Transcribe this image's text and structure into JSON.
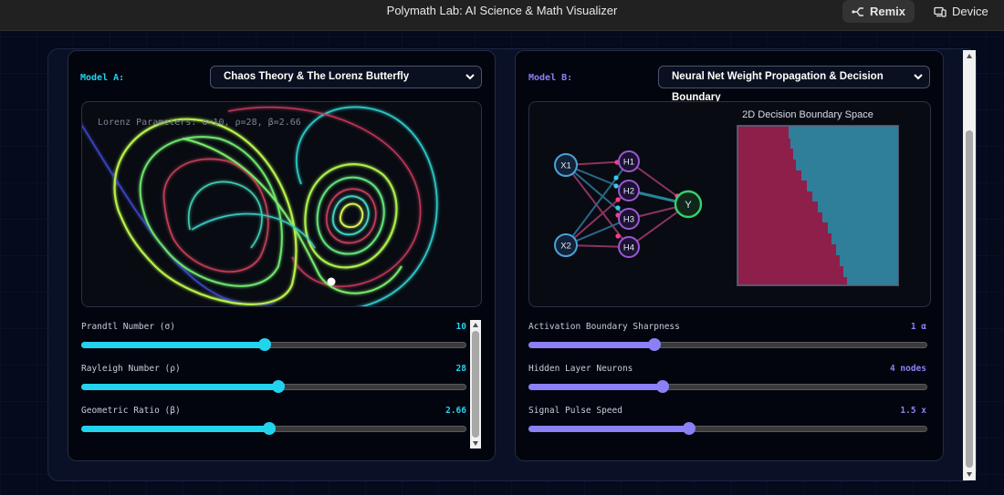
{
  "app": {
    "title": "Polymath Lab: AI Science & Math Visualizer",
    "remix_label": "Remix",
    "device_label": "Device"
  },
  "colors": {
    "accent_a": "#22d3ee",
    "accent_b": "#8b80f5",
    "boundary_red": "#8e1f4a",
    "boundary_blue": "#2f7f9a",
    "node_input": "#4aa3d6",
    "node_hidden": "#9b59d0",
    "node_output": "#34d26a"
  },
  "model_a": {
    "label": "Model A:",
    "selected": "Chaos Theory & The Lorenz Butterfly",
    "viz_label": "Lorenz Parameters: σ=10, ρ=28, β=2.66",
    "controls": [
      {
        "label": "Prandtl Number (σ)",
        "value": "10",
        "fraction": 0.475
      },
      {
        "label": "Rayleigh Number (ρ)",
        "value": "28",
        "fraction": 0.512
      },
      {
        "label": "Geometric Ratio (β)",
        "value": "2.66",
        "fraction": 0.488
      }
    ]
  },
  "model_b": {
    "label": "Model B:",
    "selected": "Neural Net Weight Propagation & Decision Boundary",
    "boundary_title": "2D Decision Boundary Space",
    "nodes": {
      "inputs": [
        "X1",
        "X2"
      ],
      "hidden": [
        "H1",
        "H2",
        "H3",
        "H4"
      ],
      "output": "Y"
    },
    "controls": [
      {
        "label": "Activation Boundary Sharpness",
        "value": "1 α",
        "fraction": 0.316
      },
      {
        "label": "Hidden Layer Neurons",
        "value": "4 nodes",
        "fraction": 0.336
      },
      {
        "label": "Signal Pulse Speed",
        "value": "1.5 x",
        "fraction": 0.402
      }
    ]
  }
}
